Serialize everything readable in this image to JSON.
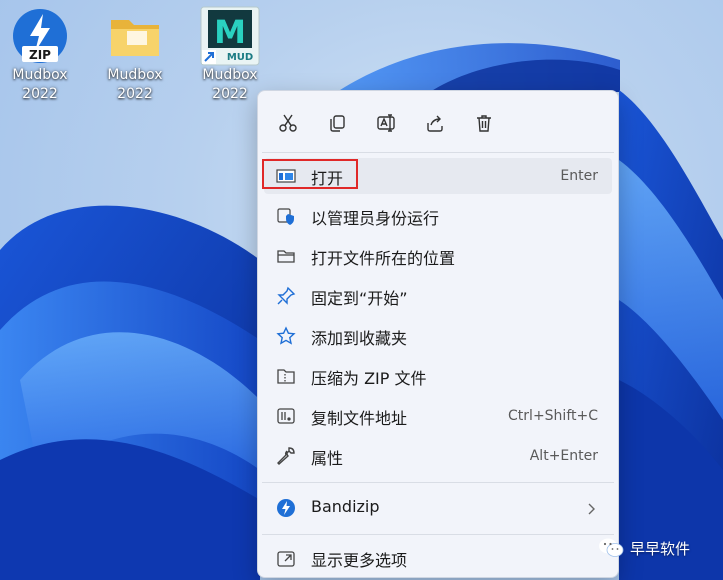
{
  "desktop": {
    "icons": [
      {
        "label_line1": "Mudbox",
        "label_line2": "2022",
        "icon": "bandizip-zip-file-icon",
        "badge": "ZIP"
      },
      {
        "label_line1": "Mudbox",
        "label_line2": "2022",
        "icon": "folder-icon"
      },
      {
        "label_line1": "Mudbox",
        "label_line2": "2022",
        "icon": "mudbox-shortcut-icon",
        "badge": "MUD",
        "logo": "M"
      }
    ]
  },
  "context_menu": {
    "toolbar": [
      "cut-icon",
      "copy-icon",
      "rename-icon",
      "share-icon",
      "delete-icon"
    ],
    "items": [
      {
        "label": "打开",
        "shortcut": "Enter",
        "icon": "open-window-icon",
        "highlighted": true
      },
      {
        "label": "以管理员身份运行",
        "shortcut": "",
        "icon": "shield-icon"
      },
      {
        "label": "打开文件所在的位置",
        "shortcut": "",
        "icon": "folder-outline-icon"
      },
      {
        "label": "固定到“开始”",
        "shortcut": "",
        "icon": "pin-icon"
      },
      {
        "label": "添加到收藏夹",
        "shortcut": "",
        "icon": "star-icon"
      },
      {
        "label": "压缩为 ZIP 文件",
        "shortcut": "",
        "icon": "zip-compress-icon"
      },
      {
        "label": "复制文件地址",
        "shortcut": "Ctrl+Shift+C",
        "icon": "copy-path-icon"
      },
      {
        "label": "属性",
        "shortcut": "Alt+Enter",
        "icon": "wrench-icon"
      },
      {
        "label": "Bandizip",
        "shortcut": "",
        "icon": "bandizip-icon",
        "submenu": true
      },
      {
        "label": "显示更多选项",
        "shortcut": "",
        "icon": "show-more-icon"
      }
    ]
  },
  "watermark": {
    "text": "早早软件",
    "icon": "wechat-icon"
  },
  "colors": {
    "accent": "#1f6fd6",
    "highlight_box": "#e02828",
    "menu_bg": "#f2f4fa"
  }
}
